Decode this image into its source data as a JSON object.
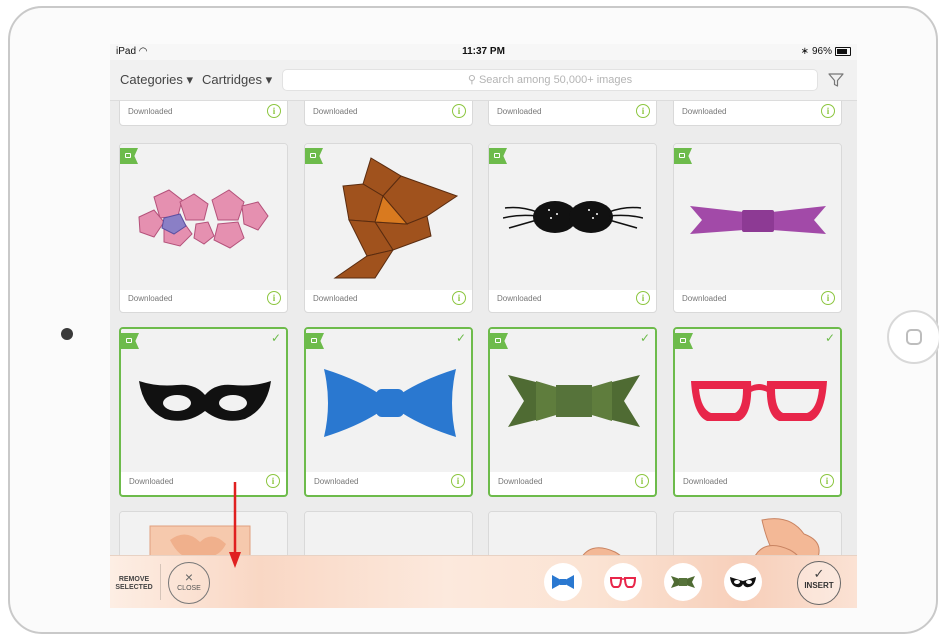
{
  "status_bar": {
    "device": "iPad",
    "time": "11:37 PM",
    "battery": "96%"
  },
  "nav": {
    "categories_label": "Categories ▾",
    "cartridges_label": "Cartridges ▾",
    "search_placeholder": "Search among 50,000+ images"
  },
  "cards": {
    "top_row": [
      {
        "label": "Downloaded",
        "info": "i"
      },
      {
        "label": "Downloaded",
        "info": "i"
      },
      {
        "label": "Downloaded",
        "info": "i"
      },
      {
        "label": "Downloaded",
        "info": "i"
      }
    ],
    "row1": [
      {
        "label": "Downloaded",
        "info": "i",
        "image": "pink-pentagon-net"
      },
      {
        "label": "Downloaded",
        "info": "i",
        "image": "brown-box-net"
      },
      {
        "label": "Downloaded",
        "info": "i",
        "image": "black-mustache"
      },
      {
        "label": "Downloaded",
        "info": "i",
        "image": "purple-ribbon-bow"
      }
    ],
    "row2": [
      {
        "label": "Downloaded",
        "info": "i",
        "image": "black-mask",
        "selected": true
      },
      {
        "label": "Downloaded",
        "info": "i",
        "image": "blue-bow-tie",
        "selected": true
      },
      {
        "label": "Downloaded",
        "info": "i",
        "image": "green-bow-tie",
        "selected": true
      },
      {
        "label": "Downloaded",
        "info": "i",
        "image": "red-glasses",
        "selected": true
      }
    ]
  },
  "tray": {
    "remove_label": "REMOVE SELECTED",
    "close_icon": "×",
    "close_label": "CLOSE",
    "insert_icon": "✓",
    "insert_label": "INSERT",
    "selected_icons": [
      "blue-bow-tie",
      "red-glasses",
      "green-bow-tie",
      "black-mask"
    ]
  },
  "colors": {
    "accent_green": "#6dbb4b",
    "info_green": "#8cc63f",
    "annotation_arrow": "#e02020"
  }
}
